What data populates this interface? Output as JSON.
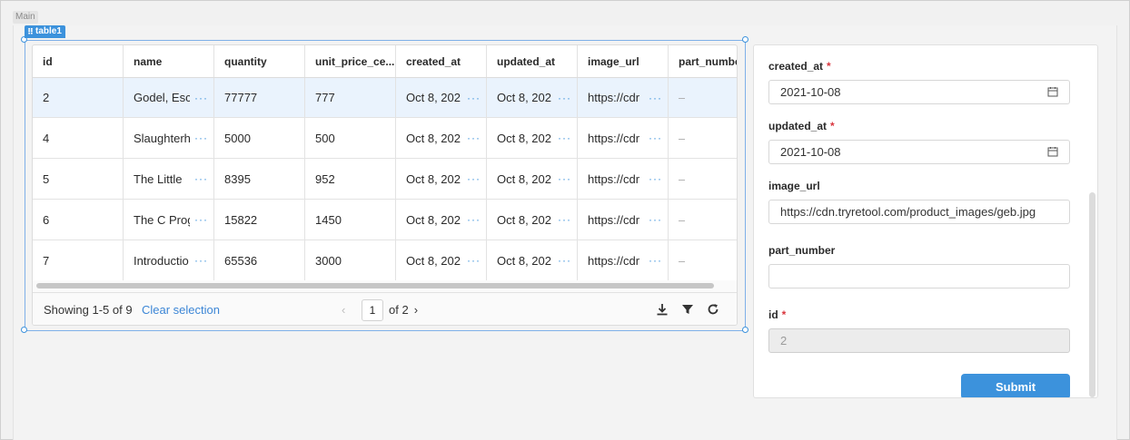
{
  "canvas": {
    "label": "Main"
  },
  "component": {
    "tag": "table1"
  },
  "table": {
    "columns": [
      "id",
      "name",
      "quantity",
      "unit_price_ce...",
      "created_at",
      "updated_at",
      "image_url",
      "part_numbe"
    ],
    "rows": [
      [
        "2",
        "Godel, Esc",
        "77777",
        "777",
        "Oct 8, 202",
        "Oct 8, 202",
        "https://cdr",
        "–"
      ],
      [
        "4",
        "Slaughterh",
        "5000",
        "500",
        "Oct 8, 202",
        "Oct 8, 202",
        "https://cdr",
        "–"
      ],
      [
        "5",
        "The Little",
        "8395",
        "952",
        "Oct 8, 202",
        "Oct 8, 202",
        "https://cdr",
        "–"
      ],
      [
        "6",
        "The C Prog",
        "15822",
        "1450",
        "Oct 8, 202",
        "Oct 8, 202",
        "https://cdr",
        "–"
      ],
      [
        "7",
        "Introductio",
        "65536",
        "3000",
        "Oct 8, 202",
        "Oct 8, 202",
        "https://cdr",
        "–"
      ]
    ],
    "footer": {
      "showing": "Showing 1-5 of 9",
      "clear_selection": "Clear selection",
      "page": "1",
      "of_pages": "of 2"
    }
  },
  "form": {
    "created_at": {
      "label": "created_at",
      "required": "*",
      "value": "2021-10-08"
    },
    "updated_at": {
      "label": "updated_at",
      "required": "*",
      "value": "2021-10-08"
    },
    "image_url": {
      "label": "image_url",
      "value": "https://cdn.tryretool.com/product_images/geb.jpg"
    },
    "part_number": {
      "label": "part_number",
      "value": ""
    },
    "id": {
      "label": "id",
      "required": "*",
      "value": "2"
    },
    "submit_label": "Submit"
  },
  "colors": {
    "accent": "#3c92dc",
    "selected_row": "#eaf3fd",
    "required": "#d9363e"
  }
}
